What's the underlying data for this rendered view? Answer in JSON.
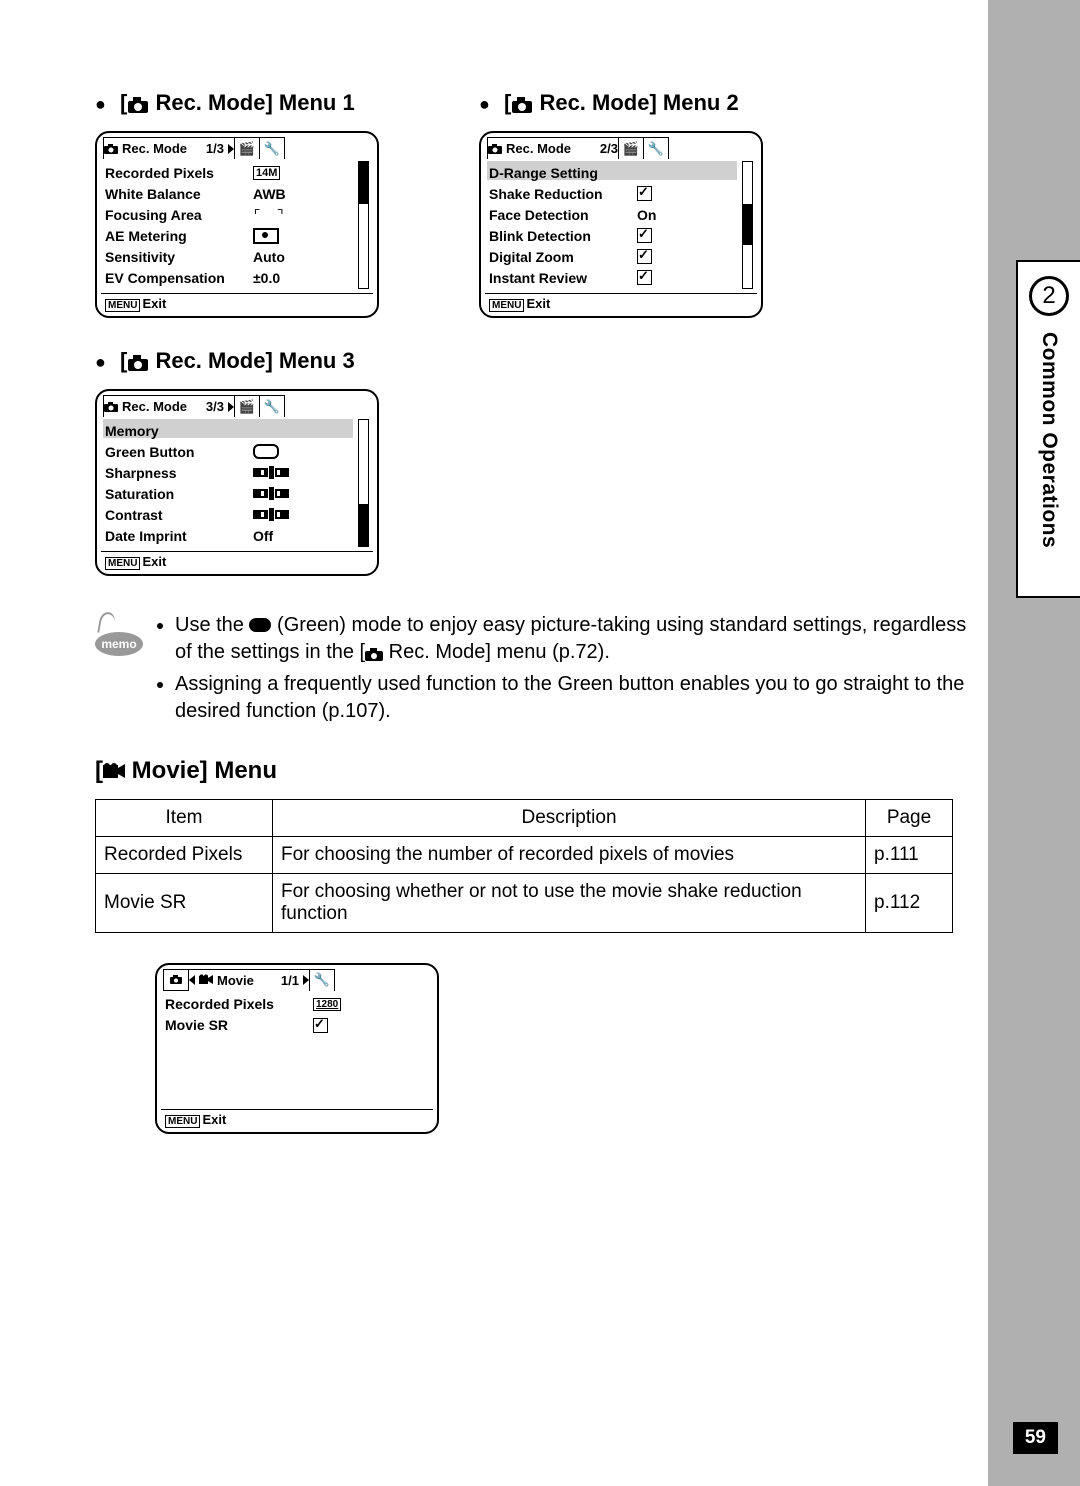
{
  "section": {
    "label": "Common Operations",
    "number": "2"
  },
  "page_number": "59",
  "rec_mode_menus": {
    "title_prefix": " Rec. Mode] Menu ",
    "menu1": {
      "heading_num": "1",
      "tab_label": "Rec. Mode",
      "page": "1/3"
    },
    "menu2": {
      "heading_num": "2",
      "tab_label": "Rec. Mode",
      "page": "2/3"
    },
    "menu3": {
      "heading_num": "3",
      "tab_label": "Rec. Mode",
      "page": "3/3"
    }
  },
  "menu1_items": [
    {
      "label": "Recorded Pixels",
      "value": "14M",
      "value_style": "boxed"
    },
    {
      "label": "White Balance",
      "value": "AWB"
    },
    {
      "label": "Focusing Area",
      "value": "[ ]",
      "value_style": "focus"
    },
    {
      "label": "AE Metering",
      "value": "",
      "value_style": "meter"
    },
    {
      "label": "Sensitivity",
      "value": "Auto"
    },
    {
      "label": "EV Compensation",
      "value": "±0.0"
    }
  ],
  "menu2_items": [
    {
      "label": "D-Range Setting",
      "value": "▶",
      "highlight": true
    },
    {
      "label": "Shake Reduction",
      "value": "check"
    },
    {
      "label": "Face Detection",
      "value": "On"
    },
    {
      "label": "Blink Detection",
      "value": "check"
    },
    {
      "label": "Digital Zoom",
      "value": "check"
    },
    {
      "label": "Instant Review",
      "value": "check"
    }
  ],
  "menu3_items": [
    {
      "label": "Memory",
      "value": "▶",
      "highlight": true
    },
    {
      "label": "Green Button",
      "value": "",
      "value_style": "roundrect"
    },
    {
      "label": "Sharpness",
      "value": "",
      "value_style": "slider"
    },
    {
      "label": "Saturation",
      "value": "",
      "value_style": "slider"
    },
    {
      "label": "Contrast",
      "value": "",
      "value_style": "slider"
    },
    {
      "label": "Date Imprint",
      "value": "Off"
    }
  ],
  "menu_exit": {
    "button": "MENU",
    "label": "Exit"
  },
  "memo": {
    "badge": "memo",
    "line1a": "Use the ",
    "line1b": " (Green) mode to enjoy easy picture-taking using standard settings, regardless of the settings in the [",
    "line1c": " Rec. Mode] menu (p.72).",
    "line2": "Assigning a frequently used function to the Green button enables you to go straight to the desired function (p.107)."
  },
  "movie_section": {
    "heading": " Movie] Menu",
    "table": {
      "headers": [
        "Item",
        "Description",
        "Page"
      ],
      "rows": [
        {
          "item": "Recorded Pixels",
          "desc": "For choosing the number of recorded pixels of movies",
          "page": "p.111"
        },
        {
          "item": "Movie SR",
          "desc": "For choosing whether or not to use the movie shake reduction function",
          "page": "p.112"
        }
      ]
    },
    "lcd": {
      "tab_label": "Movie",
      "page": "1/1",
      "items": [
        {
          "label": "Recorded Pixels",
          "value": "1280",
          "value_style": "boxed-small"
        },
        {
          "label": "Movie SR",
          "value": "check"
        }
      ]
    }
  }
}
